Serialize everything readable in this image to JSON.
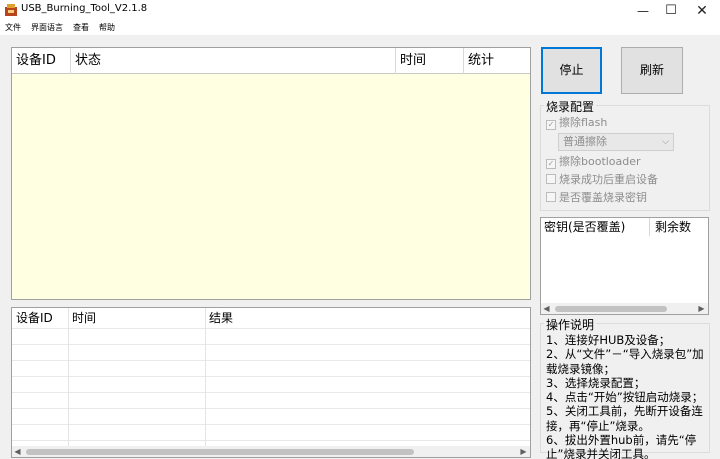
{
  "window": {
    "title": "USB_Burning_Tool_V2.1.8",
    "minimize_glyph": "—",
    "maximize_glyph": "☐",
    "close_glyph": "✕"
  },
  "menu": {
    "items": [
      {
        "label": "文件"
      },
      {
        "label": "界面语言"
      },
      {
        "label": "查看"
      },
      {
        "label": "帮助"
      }
    ]
  },
  "device_table": {
    "columns": [
      "设备ID",
      "状态",
      "时间",
      "统计"
    ]
  },
  "log_table": {
    "columns": [
      "设备ID",
      "时间",
      "结果"
    ]
  },
  "buttons": {
    "stop": "停止",
    "refresh": "刷新"
  },
  "burn_config": {
    "title": "烧录配置",
    "erase_flash": {
      "label": "擦除flash",
      "checked": true
    },
    "erase_mode": {
      "value": "普通擦除"
    },
    "erase_bootloader": {
      "label": "擦除bootloader",
      "checked": true
    },
    "reboot_after": {
      "label": "烧录成功后重启设备",
      "checked": false
    },
    "overwrite_key": {
      "label": "是否覆盖烧录密钥",
      "checked": false
    }
  },
  "key_table": {
    "columns": [
      "密钥(是否覆盖)",
      "剩余数"
    ]
  },
  "instructions": {
    "title": "操作说明",
    "lines": [
      "1、连接好HUB及设备；",
      "2、从“文件”－“导入烧录包”加载烧录镜像；",
      "3、选择烧录配置；",
      "4、点击“开始”按钮启动烧录；",
      "5、关闭工具前，先断开设备连接，再“停止”烧录。",
      "6、拔出外置hub前，请先“停止”烧录并关闭工具。"
    ]
  },
  "colors": {
    "device_list_bg": "#ffffe1",
    "accent_focus": "#0078d7"
  }
}
